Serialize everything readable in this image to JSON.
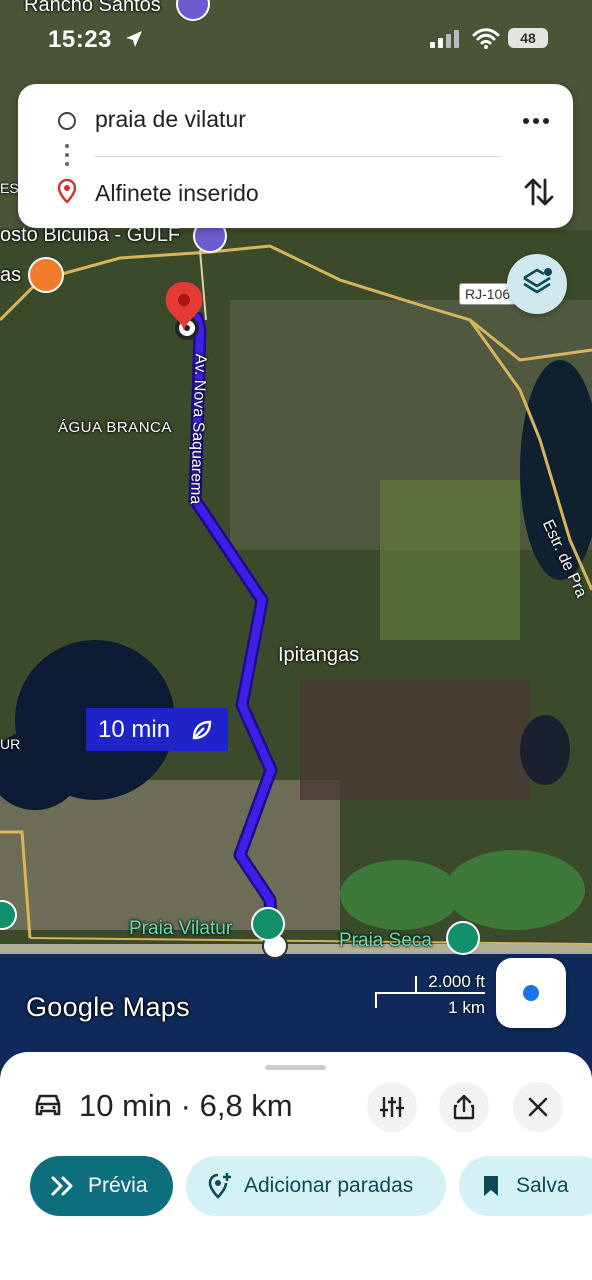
{
  "status_bar": {
    "time": "15:23",
    "battery": "48"
  },
  "search": {
    "origin": "praia de vilatur",
    "destination": "Alfinete inserido"
  },
  "map": {
    "labels": {
      "rancho_santos": "Rancho Santos",
      "posto_bicuiba": "osto Bicuiba - GULF",
      "ess": "ESS",
      "as": "as",
      "agua_branca": "ÁGUA BRANCA",
      "av_nova_saquarema": "Av. Nova Saquarema",
      "ipitangas": "Ipitangas",
      "estr_de_pra": "Estr. de Pra",
      "ur": "UR",
      "praia_vilatur": "Praia Vilatur",
      "praia_seca": "Praia Seca",
      "rj_106": "RJ-106"
    },
    "route_badge": "10 min",
    "scale_ft": "2.000 ft",
    "scale_km": "1 km",
    "logo": "Google Maps",
    "route_color": "#3f1ee8"
  },
  "sheet": {
    "summary": "10 min · 6,8 km",
    "preview_label": "Prévia",
    "add_stops_label": "Adicionar paradas",
    "save_label": "Salva"
  },
  "icons": [
    "location-arrow-icon",
    "signal-icon",
    "wifi-icon",
    "battery-icon",
    "more-icon",
    "swap-icon",
    "pin-icon",
    "layers-icon",
    "locate-icon",
    "car-icon",
    "options-icon",
    "share-icon",
    "close-icon",
    "chevrons-icon",
    "add-stop-icon",
    "bookmark-icon",
    "leaf-icon",
    "restaurant-icon",
    "gas-station-icon",
    "beach-icon"
  ]
}
